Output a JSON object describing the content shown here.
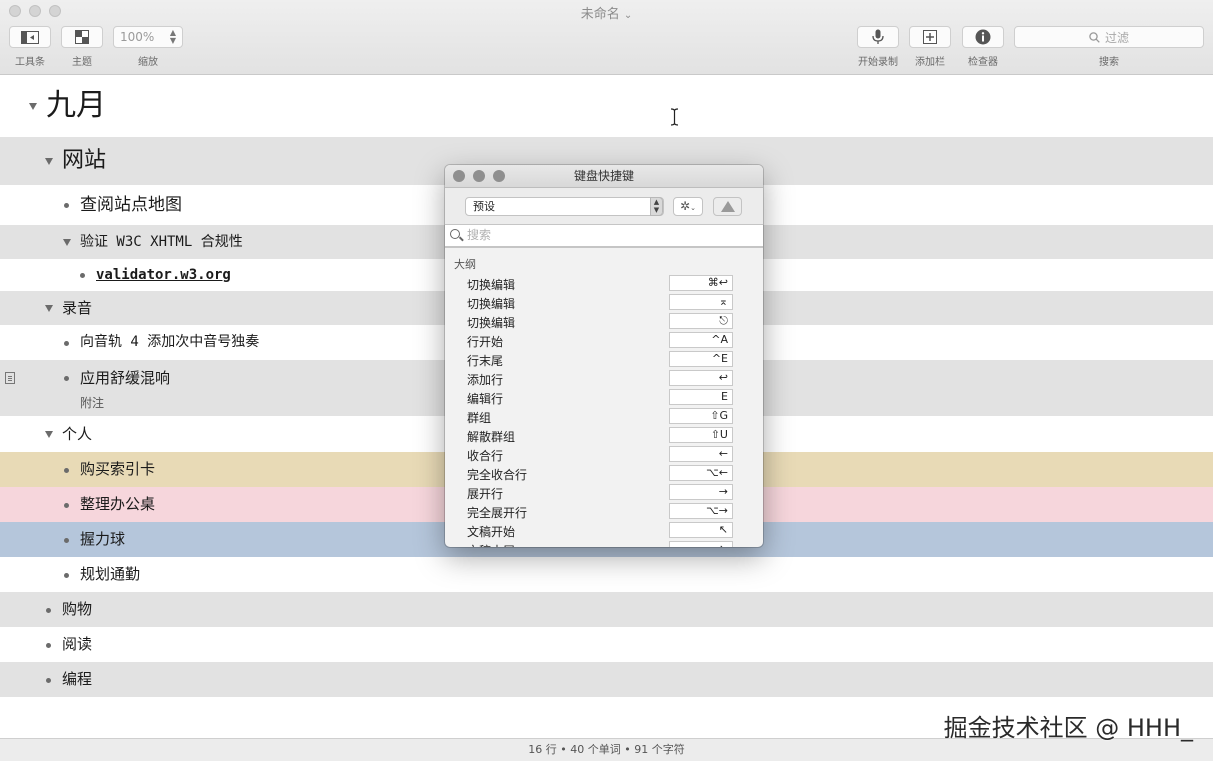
{
  "window": {
    "title": "未命名",
    "title_chevron": "⌄"
  },
  "toolbar": {
    "toolbar_label": "工具条",
    "theme_label": "主题",
    "zoom_value": "100%",
    "zoom_label": "缩放",
    "record_label": "开始录制",
    "addbar_label": "添加栏",
    "inspector_label": "检查器",
    "search_placeholder": "过滤",
    "search_label": "搜索"
  },
  "outline": {
    "rows": [
      {
        "text": "九月",
        "level": 0,
        "marker": "triangle",
        "bg": "#ffffff",
        "size": "heading1"
      },
      {
        "text": "网站",
        "level": 1,
        "marker": "triangle",
        "bg": "#e2e2e2",
        "size": "heading2"
      },
      {
        "text": "查阅站点地图",
        "level": 2,
        "marker": "dot",
        "bg": "#ffffff",
        "size": "heading3"
      },
      {
        "text": "验证 W3C XHTML 合规性",
        "level": 2,
        "marker": "triangle",
        "bg": "#e2e2e2",
        "size": "mono"
      },
      {
        "text": "validator.w3.org",
        "level": 3,
        "marker": "dot",
        "bg": "#ffffff",
        "size": "link"
      },
      {
        "text": "录音",
        "level": 1,
        "marker": "triangle",
        "bg": "#e2e2e2",
        "size": "normal"
      },
      {
        "text": "向音轨 4 添加次中音号独奏",
        "level": 2,
        "marker": "dot",
        "bg": "#ffffff",
        "size": "mono"
      },
      {
        "text": "应用舒缓混响",
        "level": 2,
        "marker": "dot",
        "bg": "#e2e2e2",
        "size": "normal",
        "note": "附注"
      },
      {
        "text": "个人",
        "level": 1,
        "marker": "triangle",
        "bg": "#ffffff",
        "size": "normal"
      },
      {
        "text": "购买索引卡",
        "level": 2,
        "marker": "dot",
        "bg": "#e8dab6",
        "size": "normal"
      },
      {
        "text": "整理办公桌",
        "level": 2,
        "marker": "dot",
        "bg": "#f6d6dc",
        "size": "normal"
      },
      {
        "text": "握力球",
        "level": 2,
        "marker": "dot",
        "bg": "#b5c6db",
        "size": "normal"
      },
      {
        "text": "规划通勤",
        "level": 2,
        "marker": "dot",
        "bg": "#ffffff",
        "size": "normal"
      },
      {
        "text": "购物",
        "level": 1,
        "marker": "dot",
        "bg": "#e2e2e2",
        "size": "normal"
      },
      {
        "text": "阅读",
        "level": 1,
        "marker": "dot",
        "bg": "#ffffff",
        "size": "normal"
      },
      {
        "text": "编程",
        "level": 1,
        "marker": "dot",
        "bg": "#e2e2e2",
        "size": "normal"
      }
    ]
  },
  "statusbar": {
    "text": "16 行 • 40 个单词 • 91 个字符"
  },
  "watermark": {
    "text": "掘金技术社区 @ HHH_"
  },
  "shortcuts_panel": {
    "title": "键盘快捷键",
    "preset": "预设",
    "search_placeholder": "搜索",
    "section": "大纲",
    "items": [
      {
        "name": "切换编辑",
        "key": "⌘↩"
      },
      {
        "name": "切换编辑",
        "key": "⌅"
      },
      {
        "name": "切换编辑",
        "key": "⎋"
      },
      {
        "name": "行开始",
        "key": "^A"
      },
      {
        "name": "行末尾",
        "key": "^E"
      },
      {
        "name": "添加行",
        "key": "↩"
      },
      {
        "name": "编辑行",
        "key": "E"
      },
      {
        "name": "群组",
        "key": "⇧G"
      },
      {
        "name": "解散群组",
        "key": "⇧U"
      },
      {
        "name": "收合行",
        "key": "←"
      },
      {
        "name": "完全收合行",
        "key": "⌥←"
      },
      {
        "name": "展开行",
        "key": "→"
      },
      {
        "name": "完全展开行",
        "key": "⌥→"
      },
      {
        "name": "文稿开始",
        "key": "↖"
      },
      {
        "name": "文稿末尾",
        "key": "↘"
      }
    ]
  }
}
